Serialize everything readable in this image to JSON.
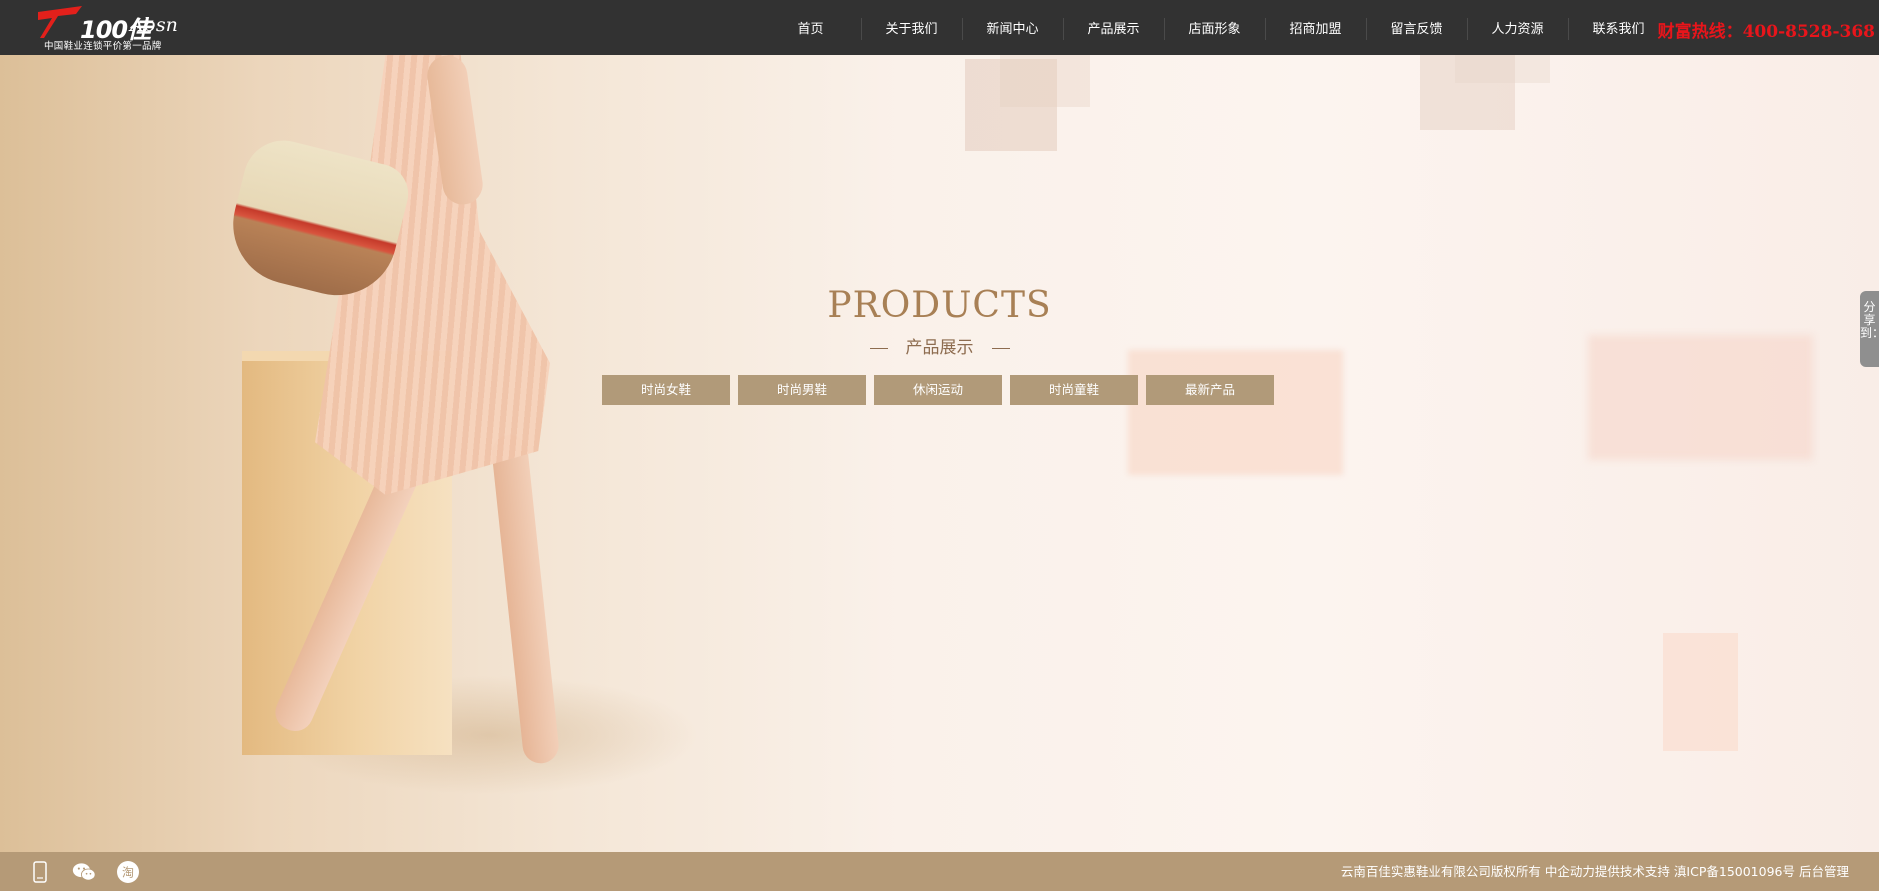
{
  "header": {
    "brand": "100佳",
    "brand_en": "Absn",
    "slogan": "中国鞋业连锁平价第一品牌",
    "nav": [
      "首页",
      "关于我们",
      "新闻中心",
      "产品展示",
      "店面形象",
      "招商加盟",
      "留言反馈",
      "人力资源",
      "联系我们"
    ],
    "hotline": "财富热线：400-8528-368"
  },
  "hero": {
    "title": "PRODUCTS",
    "subtitle": "产品展示",
    "categories": [
      "时尚女鞋",
      "时尚男鞋",
      "休闲运动",
      "时尚童鞋",
      "最新产品"
    ]
  },
  "share": {
    "label": "分享到："
  },
  "footer": {
    "icons": [
      "mobile-icon",
      "wechat-icon",
      "taobao-icon"
    ],
    "copyright": "云南百佳实惠鞋业有限公司版权所有",
    "support": "中企动力提供技术支持",
    "icp": "滇ICP备15001096号",
    "admin": "后台管理"
  },
  "colors": {
    "header_bg": "#323232",
    "hotline": "#e8151b",
    "title": "#a88055",
    "category_bg": "#b19a79",
    "footer_bg": "#b59a77"
  }
}
